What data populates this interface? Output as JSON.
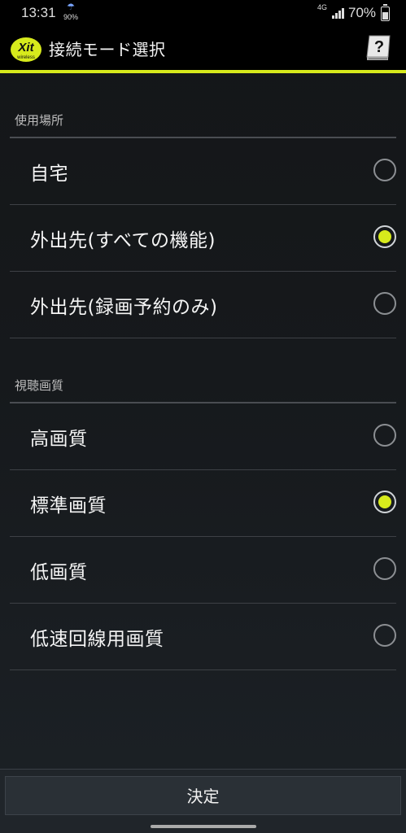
{
  "status_bar": {
    "time": "13:31",
    "notification_percent": "90%",
    "network": "4G",
    "battery": "70%"
  },
  "app_bar": {
    "logo_text": "Xit",
    "logo_subtext": "wireless",
    "title": "接続モード選択",
    "help_icon": "help-book-icon"
  },
  "sections": [
    {
      "header": "使用場所",
      "options": [
        {
          "label": "自宅",
          "selected": false
        },
        {
          "label": "外出先(すべての機能)",
          "selected": true
        },
        {
          "label": "外出先(録画予約のみ)",
          "selected": false
        }
      ]
    },
    {
      "header": "視聴画質",
      "options": [
        {
          "label": "高画質",
          "selected": false
        },
        {
          "label": "標準画質",
          "selected": true
        },
        {
          "label": "低画質",
          "selected": false
        },
        {
          "label": "低速回線用画質",
          "selected": false
        }
      ]
    }
  ],
  "footer": {
    "confirm_label": "決定"
  },
  "colors": {
    "accent": "#d7ea1c",
    "background": "#141618",
    "appbar": "#000000"
  }
}
